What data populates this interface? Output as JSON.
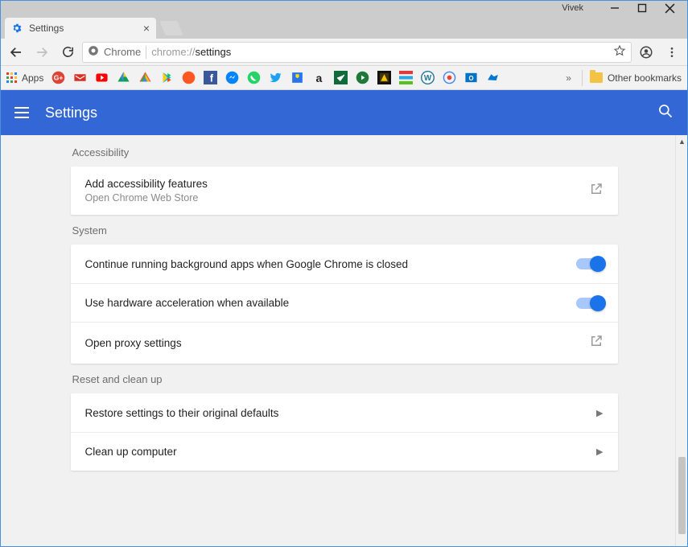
{
  "window": {
    "user": "Vivek"
  },
  "tab": {
    "title": "Settings"
  },
  "nav": {
    "origin_label": "Chrome",
    "url_prefix": "chrome://",
    "url_path": "settings"
  },
  "bookbar": {
    "apps_label": "Apps",
    "overflow": "»",
    "other_label": "Other bookmarks"
  },
  "app": {
    "title": "Settings"
  },
  "sections": {
    "accessibility": {
      "label": "Accessibility",
      "row": {
        "primary": "Add accessibility features",
        "secondary": "Open Chrome Web Store"
      }
    },
    "system": {
      "label": "System",
      "rows": [
        {
          "primary": "Continue running background apps when Google Chrome is closed",
          "type": "toggle",
          "on": true
        },
        {
          "primary": "Use hardware acceleration when available",
          "type": "toggle",
          "on": true
        },
        {
          "primary": "Open proxy settings",
          "type": "external"
        }
      ]
    },
    "reset": {
      "label": "Reset and clean up",
      "rows": [
        {
          "primary": "Restore settings to their original defaults"
        },
        {
          "primary": "Clean up computer"
        }
      ]
    }
  }
}
